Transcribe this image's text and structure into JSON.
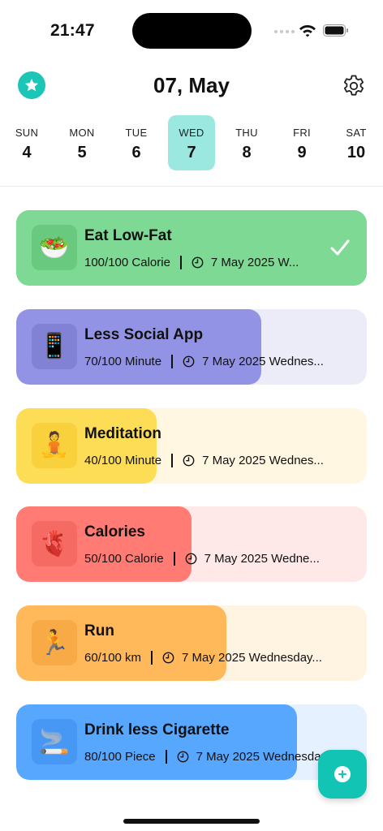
{
  "status_bar": {
    "time": "21:47"
  },
  "header": {
    "title": "07, May",
    "star_icon": "star-icon",
    "settings_icon": "gear-icon"
  },
  "week": [
    {
      "name": "SUN",
      "num": "4",
      "selected": false
    },
    {
      "name": "MON",
      "num": "5",
      "selected": false
    },
    {
      "name": "TUE",
      "num": "6",
      "selected": false
    },
    {
      "name": "WED",
      "num": "7",
      "selected": true
    },
    {
      "name": "THU",
      "num": "8",
      "selected": false
    },
    {
      "name": "FRI",
      "num": "9",
      "selected": false
    },
    {
      "name": "SAT",
      "num": "10",
      "selected": false
    }
  ],
  "habits": [
    {
      "emoji": "🥗",
      "title": "Eat Low-Fat",
      "progress": "100/100 Calorie",
      "date": "7 May 2025 W...",
      "fraction": 1.0,
      "completed": true,
      "fill_color": "#7dd993",
      "bg_color": "#7dd993",
      "icon_bg": "#69c97f"
    },
    {
      "emoji": "📱",
      "title": "Less Social App",
      "progress": "70/100 Minute",
      "date": "7 May 2025 Wednes...",
      "fraction": 0.7,
      "completed": false,
      "fill_color": "#9393e6",
      "bg_color": "#ececf9",
      "icon_bg": "#8181d6"
    },
    {
      "emoji": "🧘",
      "title": "Meditation",
      "progress": "40/100 Minute",
      "date": "7 May 2025 Wednes...",
      "fraction": 0.4,
      "completed": false,
      "fill_color": "#fddd55",
      "bg_color": "#fff7e1",
      "icon_bg": "#f8d13c"
    },
    {
      "emoji": "🫀",
      "title": "Calories",
      "progress": "50/100 Calorie",
      "date": "7 May 2025 Wedne...",
      "fraction": 0.5,
      "completed": false,
      "fill_color": "#ff7b74",
      "bg_color": "#ffe9e8",
      "icon_bg": "#f56a63"
    },
    {
      "emoji": "🏃",
      "title": "Run",
      "progress": "60/100 km",
      "date": "7 May 2025 Wednesday...",
      "fraction": 0.6,
      "completed": false,
      "fill_color": "#ffb95a",
      "bg_color": "#fff3e2",
      "icon_bg": "#f7aa45"
    },
    {
      "emoji": "🚬",
      "title": "Drink less Cigarette",
      "progress": "80/100 Piece",
      "date": "7 May 2025 Wednesday",
      "fraction": 0.8,
      "completed": false,
      "fill_color": "#58a7ff",
      "bg_color": "#e6f1ff",
      "icon_bg": "#4797f4"
    }
  ],
  "fab": {
    "icon": "plus-icon",
    "color": "#12c4b4"
  }
}
